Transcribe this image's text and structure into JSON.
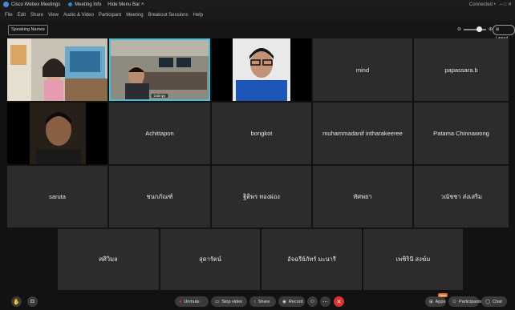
{
  "titlebar": {
    "app": "Cisco Webex Meetings",
    "meeting": "Meeting Info",
    "hide": "Hide Menu Bar ˄",
    "connected": "Connected •",
    "controls": "–  □  ✕"
  },
  "menu": [
    "File",
    "Edit",
    "Share",
    "View",
    "Audio & Video",
    "Participant",
    "Meeting",
    "Breakout Sessions",
    "Help"
  ],
  "toolbar": {
    "layout_label": "Speaking Names",
    "zoom_minus": "⊖",
    "zoom_plus": "⊕",
    "layout2": "⊞ Layout"
  },
  "participants": [
    "",
    "Dolinpy",
    "",
    "mind",
    "papassara.b",
    "",
    "Achittapon",
    "bongkot",
    "muhammadanif intharakeeree",
    "Patama Chinnawong",
    "saruta",
    "ชนกภัณฑ์",
    "ฐิติพร ทองผ่อง",
    "ทัศพยา",
    "วณัชชา ส่งเสริม",
    "ศศิวิมล",
    "สุดารัตน์",
    "อัจฉรีย์ภัทร์ มะนารี",
    "เพชิรินี สงฆ์ม"
  ],
  "bottom": {
    "unmute": "Unmute",
    "stop_video": "Stop video",
    "share": "Share",
    "record": "Record",
    "apps": "Apps",
    "apps_badge": "New",
    "participants": "Participants",
    "chat": "Chat"
  },
  "colors": {
    "tile": "#2c2c2c",
    "selected_border": "#3fc1d9",
    "leave": "#e0322f"
  }
}
